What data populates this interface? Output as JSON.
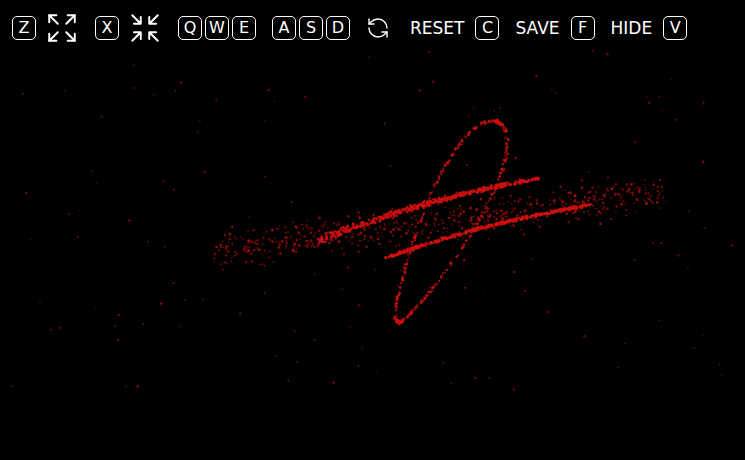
{
  "toolbar": {
    "controls": [
      {
        "keys": [
          "Z"
        ]
      },
      {
        "keys": [
          "X"
        ]
      },
      {
        "keys": [
          "Q",
          "W",
          "E"
        ]
      },
      {
        "keys": [
          "A",
          "S",
          "D"
        ]
      },
      {
        "label": "RESET",
        "keys": [
          "C"
        ]
      },
      {
        "label": "SAVE",
        "keys": [
          "F"
        ]
      },
      {
        "label": "HIDE",
        "keys": [
          "V"
        ]
      }
    ]
  }
}
